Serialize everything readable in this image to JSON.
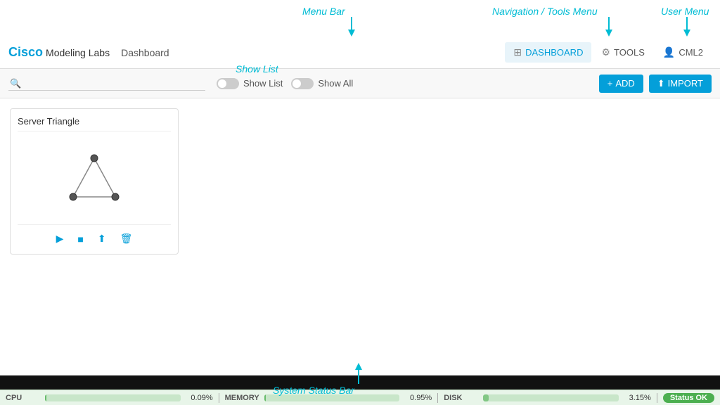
{
  "app": {
    "logo_cisco": "Cisco",
    "logo_product": "Modeling Labs",
    "page_title": "Dashboard"
  },
  "nav": {
    "dashboard_label": "DASHBOARD",
    "tools_label": "TOOLS",
    "user_label": "CML2"
  },
  "toolbar": {
    "search_placeholder": "",
    "show_list_label": "Show List",
    "show_all_label": "Show All",
    "add_label": "+ ADD",
    "import_label": "IMPORT"
  },
  "lab_card": {
    "title": "Server Triangle",
    "action_play": "▶",
    "action_stop": "■",
    "action_share": "↑",
    "action_delete": "🗑"
  },
  "status_bar": {
    "cpu_label": "CPU",
    "cpu_value": "0.09%",
    "cpu_fill_pct": 1,
    "memory_label": "MEMORY",
    "memory_value": "0.95%",
    "memory_fill_pct": 1,
    "disk_label": "DISK",
    "disk_value": "3.15%",
    "disk_fill_pct": 3,
    "status_ok": "Status OK"
  },
  "annotations": {
    "menu_bar_label": "Menu Bar",
    "nav_tools_label": "Navigation / Tools Menu",
    "user_menu_label": "User Menu",
    "show_list_label": "Show List",
    "system_status_label": "System Status Bar"
  }
}
